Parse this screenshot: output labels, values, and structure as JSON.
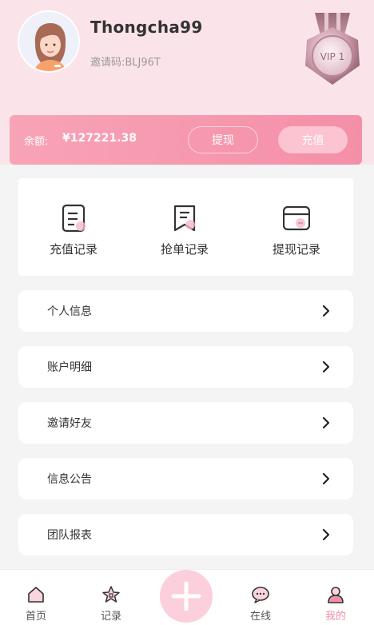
{
  "user": {
    "username": "Thongcha99",
    "invite_code": "邀请码:BLJ96T",
    "vip_label": "VIP 1"
  },
  "balance": {
    "label": "余额:",
    "value": "¥127221.38",
    "withdraw_label": "提现",
    "recharge_label": "充值"
  },
  "quick_actions": [
    {
      "label": "充值记录",
      "icon": "recharge-record-icon"
    },
    {
      "label": "抢单记录",
      "icon": "grab-order-record-icon"
    },
    {
      "label": "提现记录",
      "icon": "withdraw-record-icon"
    }
  ],
  "menu": [
    {
      "label": "个人信息"
    },
    {
      "label": "账户明细"
    },
    {
      "label": "邀请好友"
    },
    {
      "label": "信息公告"
    },
    {
      "label": "团队报表"
    }
  ],
  "tabbar": {
    "items": [
      {
        "label": "首页",
        "icon": "home-icon"
      },
      {
        "label": "记录",
        "icon": "record-icon"
      },
      {
        "label": "在线",
        "icon": "chat-icon"
      },
      {
        "label": "我的",
        "icon": "profile-icon"
      }
    ],
    "active_index": 3
  },
  "colors": {
    "header_bg": "#fbe3ea",
    "accent": "#f48fa8",
    "balance_gradient_start": "#f8a3b6",
    "center_button": "#fbcfdb"
  }
}
